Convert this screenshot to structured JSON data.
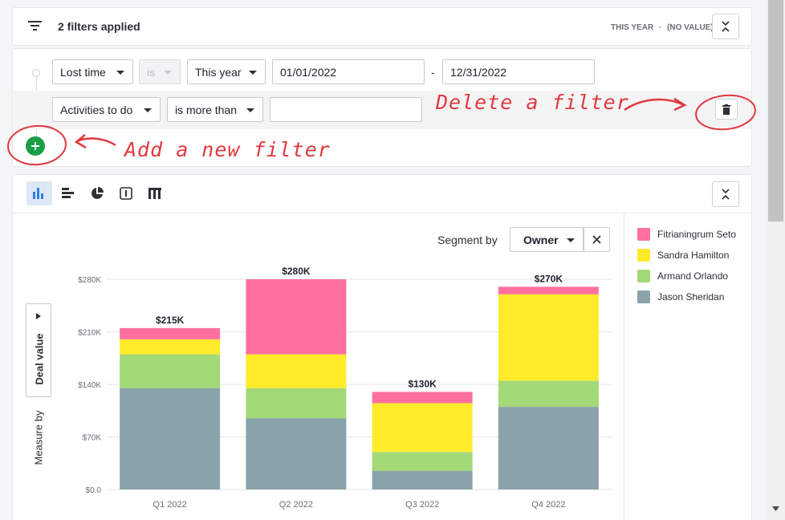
{
  "filter_header": {
    "title": "2 filters applied",
    "summary_period": "THIS YEAR",
    "summary_sep": "·",
    "summary_value": "(NO VALUE)"
  },
  "filters": [
    {
      "field": "Lost time",
      "operator": "is",
      "operator_disabled": true,
      "value_select": "This year",
      "date_from": "01/01/2022",
      "date_sep": "-",
      "date_to": "12/31/2022"
    },
    {
      "field": "Activities to do",
      "operator": "is more than",
      "value": "",
      "delete_icon": "trash-icon"
    }
  ],
  "add_filter_icon": "plus-circle-icon",
  "annotations": {
    "delete": "Delete a filter",
    "add": "Add a new filter"
  },
  "toolbar": {
    "chart_types": [
      "bar-chart-icon",
      "horizontal-bar-icon",
      "pie-chart-icon",
      "scorecard-icon",
      "table-icon"
    ],
    "active": "bar-chart-icon",
    "collapse_icon": "collapse-icon"
  },
  "segment": {
    "label": "Segment by",
    "value": "Owner",
    "clear_icon": "close-icon"
  },
  "measure": {
    "label": "Measure by",
    "value": "Deal value"
  },
  "colors": {
    "Fitrianingrum Seto": "#ff70a0",
    "Sandra Hamilton": "#ffeb2a",
    "Armand Orlando": "#a3d977",
    "Jason Sheridan": "#8aa3ab",
    "accent": "#2f7de1",
    "add_button": "#1a9e45",
    "annotation": "#e0393e"
  },
  "chart_data": {
    "type": "bar",
    "stacked": true,
    "categories": [
      "Q1 2022",
      "Q2 2022",
      "Q3 2022",
      "Q4 2022"
    ],
    "series": [
      {
        "name": "Jason Sheridan",
        "values": [
          135000,
          95000,
          25000,
          110000
        ]
      },
      {
        "name": "Armand Orlando",
        "values": [
          45000,
          40000,
          25000,
          35000
        ]
      },
      {
        "name": "Sandra Hamilton",
        "values": [
          20000,
          45000,
          65000,
          115000
        ]
      },
      {
        "name": "Fitrianingrum Seto",
        "values": [
          15000,
          100000,
          15000,
          10000
        ]
      }
    ],
    "totals": [
      "$215K",
      "$280K",
      "$130K",
      "$270K"
    ],
    "ylim": [
      0,
      280000
    ],
    "yticks": [
      0,
      70000,
      140000,
      210000,
      280000
    ],
    "ytick_labels": [
      "$0.0",
      "$70K",
      "$140K",
      "$210K",
      "$280K"
    ],
    "grid": true,
    "legend": "right"
  }
}
